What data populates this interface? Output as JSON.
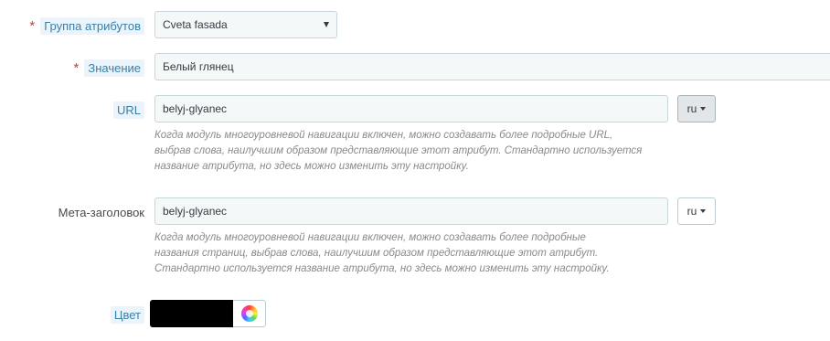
{
  "attribute_group": {
    "label": "Группа атрибутов",
    "required_mark": "*",
    "selected": "Cveta fasada"
  },
  "value": {
    "label": "Значение",
    "required_mark": "*",
    "input_value": "Белый глянец"
  },
  "url": {
    "label": "URL",
    "input_value": "belyj-glyanec",
    "language": "ru",
    "help_lines": [
      "Когда модуль многоуровневой навигации включен, можно создавать более подробные URL,",
      "выбрав слова, наилучшим образом представляющие этот атрибут. Стандартно используется",
      "название атрибута, но здесь можно изменить эту настройку."
    ]
  },
  "meta_title": {
    "label": "Мета-заголовок",
    "input_value": "belyj-glyanec",
    "language": "ru",
    "help_lines": [
      "Когда модуль многоуровневой навигации включен, можно создавать более подробные",
      "названия страниц, выбрав слова, наилучшим образом представляющие этот атрибут.",
      "Стандартно используется название атрибута, но здесь можно изменить эту настройку."
    ]
  },
  "color": {
    "label": "Цвет",
    "swatch_color": "#000000",
    "picker_icon": "color-wheel-icon"
  },
  "colors": {
    "required": "#e23333",
    "label_bg": "#eaf4fa",
    "label_text": "#3a7fa8",
    "input_bg": "#f5f8f9",
    "help_text": "#8a8a8a"
  }
}
